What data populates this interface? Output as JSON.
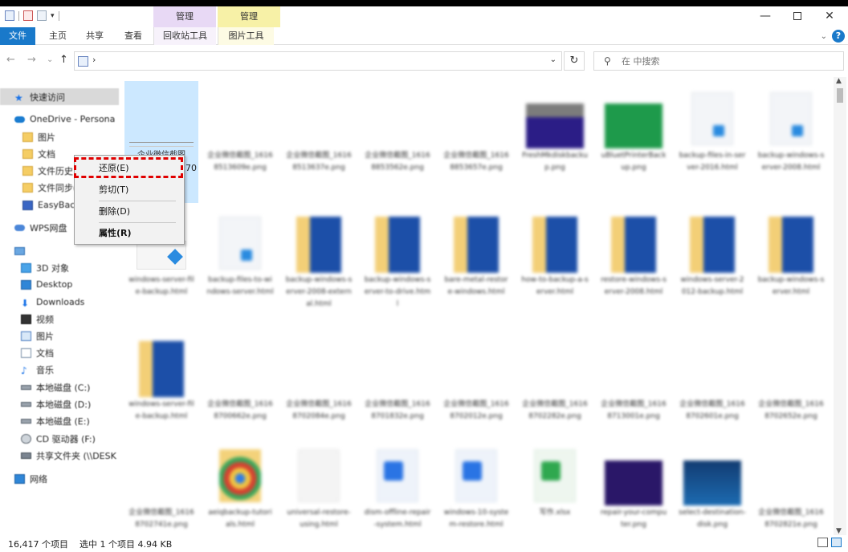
{
  "ribbon": {
    "contextual_headers": [
      "管理",
      "管理"
    ],
    "tabs": [
      "文件",
      "主页",
      "共享",
      "查看",
      "回收站工具",
      "图片工具"
    ]
  },
  "window_controls": {
    "minimize": "—",
    "close": "✕"
  },
  "address": {
    "arrow": "›",
    "dropdown": "⌄",
    "refresh": "↻"
  },
  "search": {
    "placeholder": "在 中搜索",
    "icon": "search-icon"
  },
  "nav": {
    "back": "←",
    "forward": "→",
    "recent": "⌄",
    "up": "↑",
    "items": [
      {
        "label": "快速访问",
        "icon": "star-icon"
      },
      {
        "label": "OneDrive - Persona",
        "icon": "cloud-icon"
      },
      {
        "label": "图片",
        "icon": "folder-icon"
      },
      {
        "label": "文档",
        "icon": "folder-icon"
      },
      {
        "label": "文件历史",
        "icon": "folder-icon"
      },
      {
        "label": "文件同步(",
        "icon": "folder-icon"
      },
      {
        "label": "EasyBack",
        "icon": "easyback-icon"
      },
      {
        "label": "WPS网盘",
        "icon": "cloud-icon"
      },
      {
        "label": "",
        "icon": "this-pc-icon"
      },
      {
        "label": "3D 对象",
        "icon": "cube-icon"
      },
      {
        "label": "Desktop",
        "icon": "desktop-icon"
      },
      {
        "label": "Downloads",
        "icon": "download-icon"
      },
      {
        "label": "视频",
        "icon": "video-icon"
      },
      {
        "label": "图片",
        "icon": "picture-icon"
      },
      {
        "label": "文档",
        "icon": "document-icon"
      },
      {
        "label": "音乐",
        "icon": "music-icon"
      },
      {
        "label": "本地磁盘 (C:)",
        "icon": "drive-icon"
      },
      {
        "label": "本地磁盘 (D:)",
        "icon": "drive-icon"
      },
      {
        "label": "本地磁盘 (E:)",
        "icon": "drive-icon"
      },
      {
        "label": "CD 驱动器 (F:)",
        "icon": "cd-drive-icon"
      },
      {
        "label": "共享文件夹 (\\\\DESK",
        "icon": "shared-folder-icon"
      },
      {
        "label": "网络",
        "icon": "network-icon"
      }
    ]
  },
  "files": {
    "selected": {
      "name": "企业微信截图",
      "name_tail": "70"
    },
    "blurred": [
      "企业微信截图_16168513609e.png",
      "企业微信截图_16168513637e.png",
      "企业微信截图_16168853562e.png",
      "企业微信截图_16168853657e.png",
      "FreshMkdiskbackup.png",
      "uBluetPrinterBackup.png",
      "backup-files-in-server-2016.html",
      "backup-windows-server-2008.html",
      "backup-windows-server.html",
      "backup-files-to-windows-server.html",
      "backup-windows-server-2008-external.html",
      "backup-windows-server-to-drive.html",
      "bare-metal-restore-windows.html",
      "how-to-backup-a-server.html",
      "restore-windows-server-2008.html",
      "windows-server-2012-backup.html",
      "windows-server-file-backup.html",
      "企业微信截图_16168700662e.png",
      "企业微信截图_16168702084e.png",
      "企业微信截图_16168701832e.png",
      "企业微信截图_16168702012e.png",
      "企业微信截图_16168702282e.png",
      "企业微信截图_16168713001e.png",
      "企业微信截图_16168702601e.png",
      "企业微信截图_16168702652e.png",
      "企业微信截图_16168702741e.png",
      "aeiqbackup-tutorials.html",
      "universal-restore-using.html",
      "dism-offline-repair-system.html",
      "windows-10-system-restore.html",
      "写作.xlsx",
      "repair-your-computer.png",
      "select-destination-disk.png",
      "企业微信截图_16168702821e.png"
    ]
  },
  "context_menu": {
    "restore": "还原(E)",
    "cut": "剪切(T)",
    "delete": "删除(D)",
    "properties": "属性(R)"
  },
  "status": {
    "count": "16,417 个项目",
    "selection": "选中 1 个项目  4.94 KB"
  },
  "colors": {
    "accent": "#1979ca",
    "highlight_border": "#e00000",
    "selection_bg": "#cce8ff",
    "ctx_purple": "#e8d9f5",
    "ctx_yellow": "#f7f1a7"
  }
}
